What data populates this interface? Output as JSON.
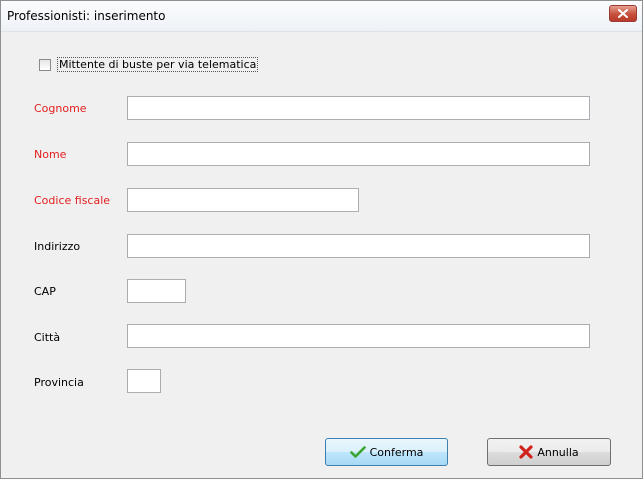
{
  "window": {
    "title": "Professionisti: inserimento"
  },
  "options": {
    "telematic_sender_label": "Mittente di buste per via telematica",
    "telematic_sender_checked": false
  },
  "form": {
    "cognome": {
      "label": "Cognome",
      "value": "",
      "required": true
    },
    "nome": {
      "label": "Nome",
      "value": "",
      "required": true
    },
    "codice_fiscale": {
      "label": "Codice fiscale",
      "value": "",
      "required": true
    },
    "indirizzo": {
      "label": "Indirizzo",
      "value": "",
      "required": false
    },
    "cap": {
      "label": "CAP",
      "value": "",
      "required": false
    },
    "citta": {
      "label": "Città",
      "value": "",
      "required": false
    },
    "provincia": {
      "label": "Provincia",
      "value": "",
      "required": false
    }
  },
  "buttons": {
    "confirm_label": "Conferma",
    "cancel_label": "Annulla"
  },
  "icons": {
    "close": "close-icon",
    "confirm": "checkmark-icon",
    "cancel": "red-x-icon"
  },
  "colors": {
    "required_label": "#e21f1f",
    "close_button": "#c7503d",
    "confirm_check": "#3aa52f",
    "cancel_x": "#d0231b"
  }
}
